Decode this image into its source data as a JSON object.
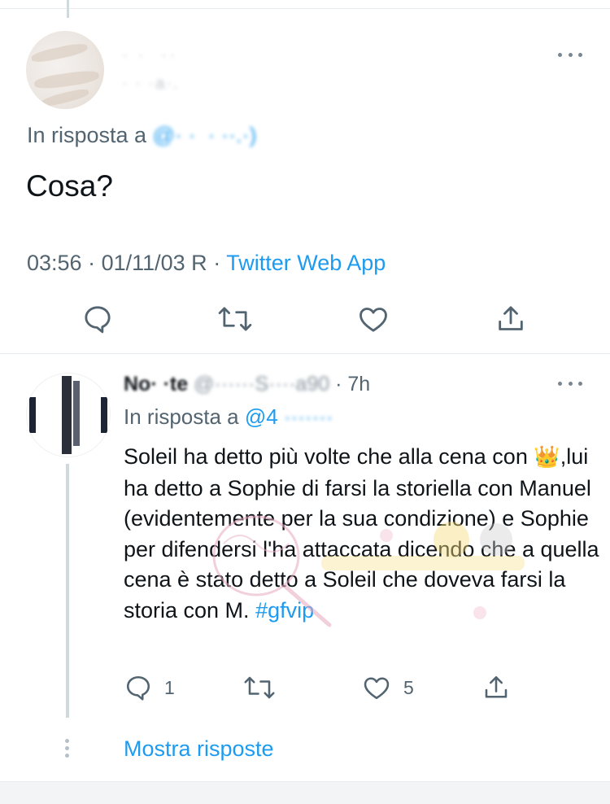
{
  "colors": {
    "accent": "#1d9bf0",
    "secondary_text": "#536471",
    "primary_text": "#0f1419",
    "divider": "#e6ecf0"
  },
  "main_tweet": {
    "author_name": "· ·  ··",
    "author_handle": "· · ·a·.",
    "reply_prefix": "In risposta a ",
    "reply_handle": "@· ·  · ··.·)",
    "text": "Cosa?",
    "time": "03:56",
    "date": "01/11/03 R",
    "sep": " · ",
    "source": "Twitter Web App",
    "actions": [
      {
        "name": "reply",
        "icon": "comment-icon"
      },
      {
        "name": "retweet",
        "icon": "retweet-icon"
      },
      {
        "name": "like",
        "icon": "heart-icon"
      },
      {
        "name": "share",
        "icon": "share-icon"
      }
    ]
  },
  "reply_tweet": {
    "author_name": "No· ·te",
    "author_handle": "@······S····a90",
    "time_sep": " · ",
    "time": "7h",
    "reply_prefix": "In risposta a ",
    "reply_handle": "@4",
    "reply_handle_blurred": " ·······",
    "text_part1": "Soleil ha detto più volte che alla cena con",
    "crown_emoji": "👑",
    "text_part2": ",lui ha detto a Sophie di farsi la storiella con Manuel (evidentemente per la sua condizione) e Sophie per difendersi l'ha attaccata dicendo che a quella cena è stato detto a Soleil che doveva farsi la storia con M. ",
    "hashtag": "#gfvip",
    "reply_count": "1",
    "like_count": "5"
  },
  "show_replies": "Mostra risposte"
}
